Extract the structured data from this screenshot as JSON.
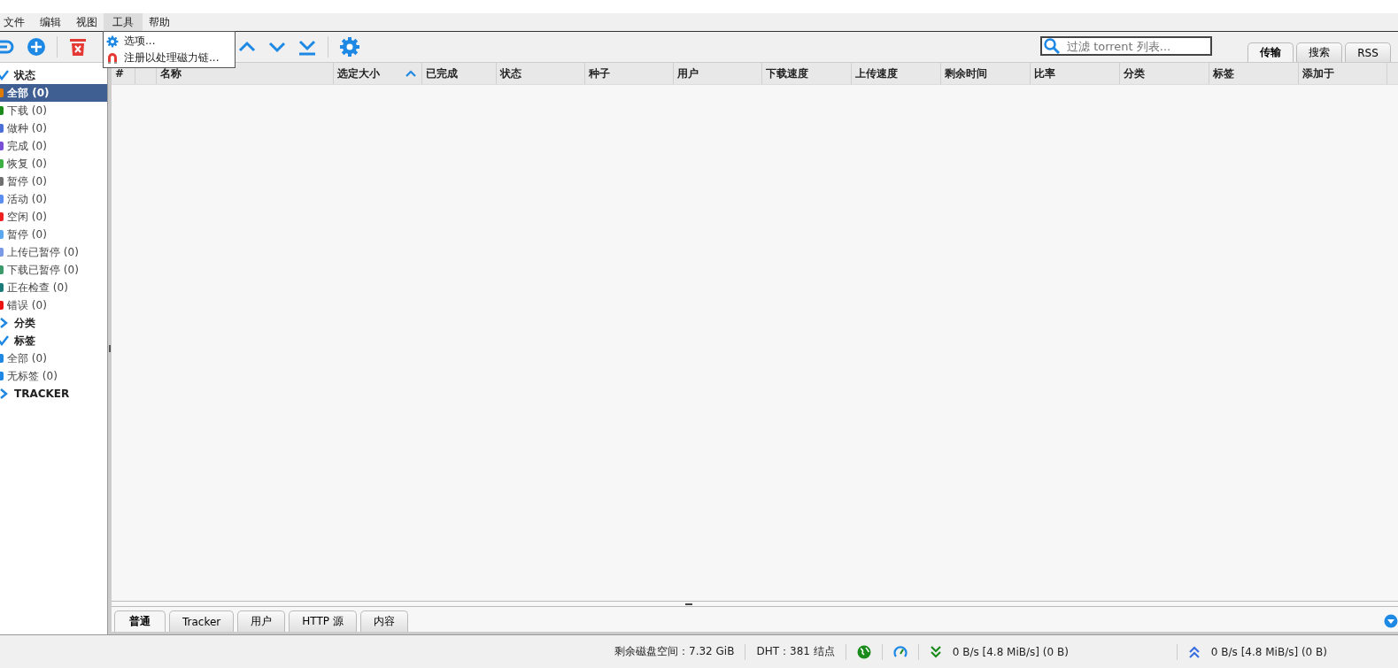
{
  "menu_bar": {
    "items": [
      {
        "label": "文件",
        "selected": false
      },
      {
        "label": "编辑",
        "selected": false
      },
      {
        "label": "视图",
        "selected": false
      },
      {
        "label": "工具",
        "selected": true
      },
      {
        "label": "帮助",
        "selected": false
      }
    ]
  },
  "dropdown": {
    "items": [
      {
        "label": "选项...",
        "kind": "gear"
      },
      {
        "label": "注册以处理磁力链...",
        "kind": "magnet"
      }
    ]
  },
  "toolbar": {
    "search": {
      "placeholder": "过滤 torrent 列表..."
    }
  },
  "view_tabs": [
    {
      "label": "传输",
      "selected": true
    },
    {
      "label": "搜索",
      "selected": false
    },
    {
      "label": "RSS",
      "selected": false
    }
  ],
  "sidebar": {
    "sections": [
      {
        "title": "状态",
        "expanded": true,
        "items": [
          {
            "label": "全部 (0)",
            "selected": true,
            "color": "#e07b00"
          },
          {
            "label": "下载 (0)",
            "selected": false,
            "color": "#1a8a1a"
          },
          {
            "label": "做种 (0)",
            "selected": false,
            "color": "#4a6fd8"
          },
          {
            "label": "完成 (0)",
            "selected": false,
            "color": "#7a4fd8"
          },
          {
            "label": "恢复 (0)",
            "selected": false,
            "color": "#3cb043"
          },
          {
            "label": "暂停 (0)",
            "selected": false,
            "color": "#707070"
          },
          {
            "label": "活动 (0)",
            "selected": false,
            "color": "#5b8ef0"
          },
          {
            "label": "空闲 (0)",
            "selected": false,
            "color": "#f02020"
          },
          {
            "label": "暂停 (0)",
            "selected": false,
            "color": "#5ba8f0"
          },
          {
            "label": "上传已暂停 (0)",
            "selected": false,
            "color": "#7a9ae8"
          },
          {
            "label": "下载已暂停 (0)",
            "selected": false,
            "color": "#3c9a6a"
          },
          {
            "label": "正在检查 (0)",
            "selected": false,
            "color": "#1a7a7a"
          },
          {
            "label": "错误 (0)",
            "selected": false,
            "color": "#ee1111"
          }
        ]
      },
      {
        "title": "分类",
        "expanded": false
      },
      {
        "title": "标签",
        "expanded": true,
        "items": [
          {
            "label": "全部 (0)",
            "selected": false,
            "color": "#1e88e5"
          },
          {
            "label": "无标签 (0)",
            "selected": false,
            "color": "#1e88e5"
          }
        ]
      },
      {
        "title": "TRACKER",
        "expanded": false
      }
    ]
  },
  "table": {
    "columns": [
      {
        "label": "#",
        "sorted": false
      },
      {
        "sorted": false
      },
      {
        "label": "名称",
        "sorted": false
      },
      {
        "label": "选定大小",
        "sorted": true
      },
      {
        "label": "已完成",
        "sorted": false
      },
      {
        "label": "状态",
        "sorted": false
      },
      {
        "label": "种子",
        "sorted": false
      },
      {
        "label": "用户",
        "sorted": false
      },
      {
        "label": "下载速度",
        "sorted": false
      },
      {
        "label": "上传速度",
        "sorted": false
      },
      {
        "label": "剩余时间",
        "sorted": false
      },
      {
        "label": "比率",
        "sorted": false
      },
      {
        "label": "分类",
        "sorted": false
      },
      {
        "label": "标签",
        "sorted": false
      },
      {
        "label": "添加于",
        "sorted": false
      }
    ]
  },
  "detail_tabs": [
    {
      "label": "普通",
      "selected": true
    },
    {
      "label": "Tracker",
      "selected": false
    },
    {
      "label": "用户",
      "selected": false
    },
    {
      "label": "HTTP 源",
      "selected": false
    },
    {
      "label": "内容",
      "selected": false
    }
  ],
  "status_bar": {
    "free_space": "剩余磁盘空间：7.32 GiB",
    "dht": "DHT：381 结点",
    "download": "0 B/s [4.8 MiB/s] (0 B)",
    "upload": "0 B/s [4.8 MiB/s] (0 B)"
  }
}
